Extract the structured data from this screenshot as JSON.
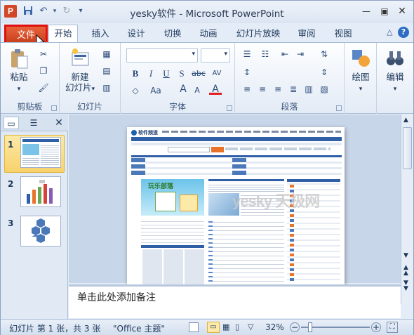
{
  "window": {
    "title": "yesky软件 - Microsoft PowerPoint",
    "app_icon_letter": "P"
  },
  "qat": {
    "save_icon": "save-icon",
    "undo_icon": "undo-icon",
    "redo_icon": "redo-icon",
    "customize": "▾"
  },
  "tabs": {
    "file": "文件",
    "items": [
      "开始",
      "插入",
      "设计",
      "切换",
      "动画",
      "幻灯片放映",
      "审阅",
      "视图"
    ]
  },
  "ribbon": {
    "clipboard": {
      "label": "剪贴板",
      "paste": "粘贴"
    },
    "slides": {
      "label": "幻灯片",
      "new_slide_1": "新建",
      "new_slide_2": "幻灯片"
    },
    "font": {
      "label": "字体",
      "bold": "B",
      "italic": "I",
      "underline": "U",
      "strike": "S",
      "shadow": "abc",
      "spacing": "AV",
      "case": "Aa",
      "grow": "A",
      "shrink": "A",
      "color": "A"
    },
    "paragraph": {
      "label": "段落"
    },
    "drawing": {
      "label": "绘图"
    },
    "editing": {
      "label": "编辑"
    }
  },
  "left_pane": {
    "slides": [
      {
        "num": "1"
      },
      {
        "num": "2"
      },
      {
        "num": "3"
      }
    ]
  },
  "notes": {
    "placeholder": "单击此处添加备注"
  },
  "slide_content": {
    "site_name": "软件频道",
    "watermark": "yesky 天极网",
    "banner": "玩乐部落"
  },
  "status": {
    "slide_info": "幻灯片 第 1 张，共 3 张",
    "theme": "\"Office 主题\"",
    "zoom": "32%"
  },
  "colors": {
    "file_tab": "#d24726",
    "highlight_border": "#e01010",
    "accent": "#2b579a"
  }
}
